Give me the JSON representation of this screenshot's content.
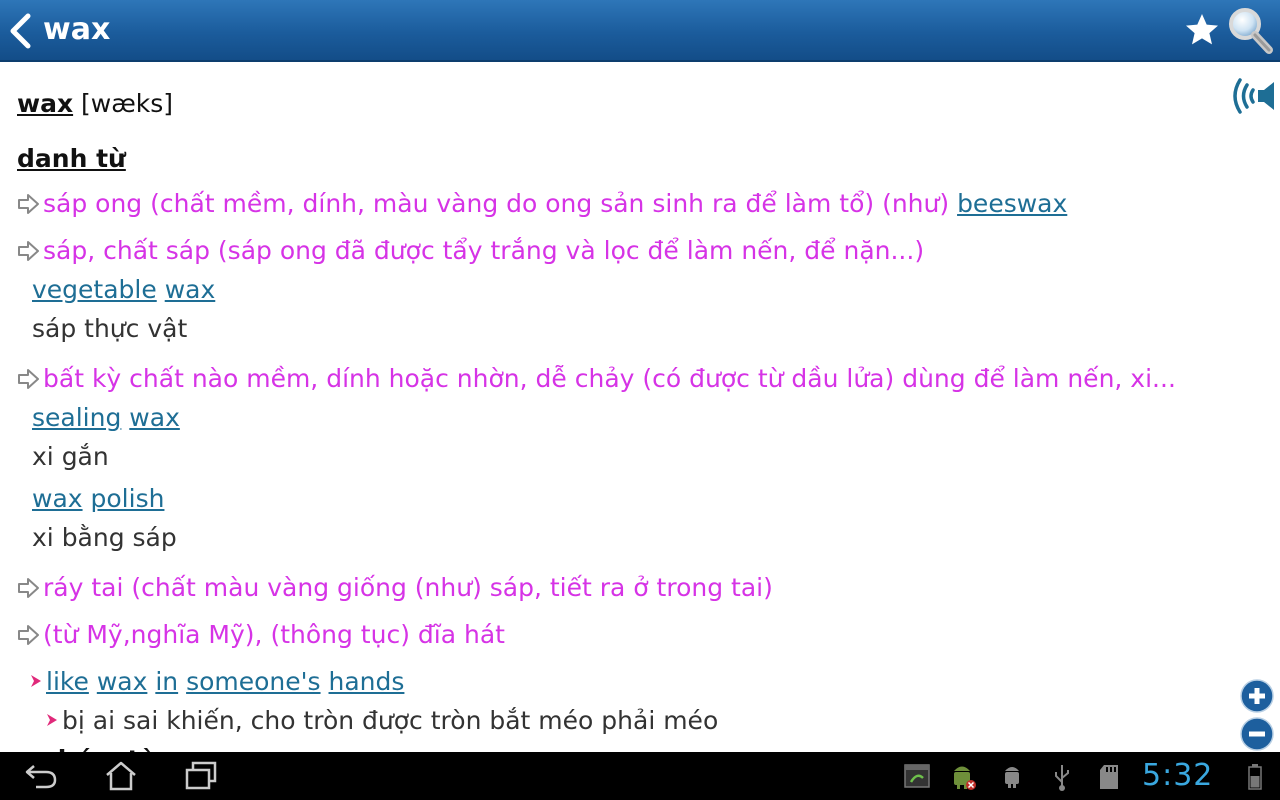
{
  "header": {
    "title": "wax"
  },
  "entry": {
    "headword": "wax",
    "pronunciation": "[wæks]",
    "part_of_speech": "danh từ",
    "senses": [
      {
        "text": "sáp ong (chất mềm, dính, màu vàng do ong sản sinh ra để làm tổ) (như) ",
        "link": "beeswax"
      },
      {
        "text": "sáp, chất sáp (sáp ong đã được tẩy trắng và lọc để làm nến, để nặn...)",
        "examples": [
          {
            "words": [
              "vegetable",
              "wax"
            ],
            "translation": "sáp thực vật"
          }
        ]
      },
      {
        "text": "bất kỳ chất nào mềm, dính hoặc nhờn, dễ chảy (có được từ dầu lửa) dùng để làm nến, xi...",
        "examples": [
          {
            "words": [
              "sealing",
              "wax"
            ],
            "translation": "xi gắn"
          },
          {
            "words": [
              "wax",
              "polish"
            ],
            "translation": "xi bằng sáp"
          }
        ]
      },
      {
        "text": "ráy tai (chất màu vàng giống (như) sáp, tiết ra ở trong tai)"
      },
      {
        "text": "(từ Mỹ,nghĩa Mỹ), (thông tục) đĩa hát"
      }
    ],
    "idioms": [
      {
        "words": [
          "like",
          "wax",
          "in",
          "someone's",
          "hands"
        ],
        "translation": "bị ai sai khiến, cho tròn được tròn bắt méo phải méo"
      }
    ],
    "clipped_text": "nhóm từ"
  },
  "status": {
    "clock": "5:32"
  },
  "colors": {
    "header_bg": "#1b5c9c",
    "sense_text": "#d633e6",
    "link": "#1e6e95",
    "clock": "#3aa8e0"
  }
}
